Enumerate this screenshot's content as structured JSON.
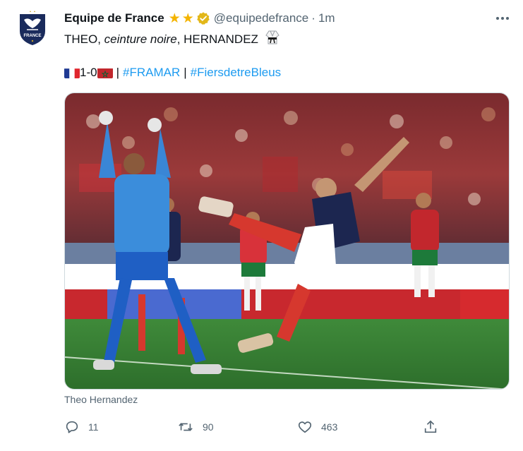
{
  "tweet": {
    "display_name": "Equipe de France",
    "handle": "@equipedefrance",
    "separator": "·",
    "time": "1m",
    "text_line1": {
      "part1": "THEO, ",
      "italic": "ceinture noire",
      "part2": ", HERNANDEZ"
    },
    "text_line2": {
      "score": "1-0",
      "divider": "|",
      "hashtag1": "#FRAMAR",
      "hashtag2": "#FiersdetreBleus"
    },
    "media_caption": "Theo Hernandez",
    "more_label": "···"
  },
  "avatar": {
    "crest_text": "FRANCE"
  },
  "icons": {
    "verified": "verified-badge-icon",
    "stars": [
      "star-icon",
      "star-icon"
    ],
    "belt": "martial-arts-uniform-icon",
    "flags": [
      "flag-france-icon",
      "flag-morocco-icon"
    ],
    "reply": "reply-icon",
    "retweet": "retweet-icon",
    "like": "heart-icon",
    "share": "share-icon"
  },
  "actions": {
    "replies": "11",
    "retweets": "90",
    "likes": "463"
  },
  "colors": {
    "link": "#1d9bf0",
    "secondary_text": "#536471",
    "star": "#f4b400",
    "verified": "#e2b719"
  }
}
